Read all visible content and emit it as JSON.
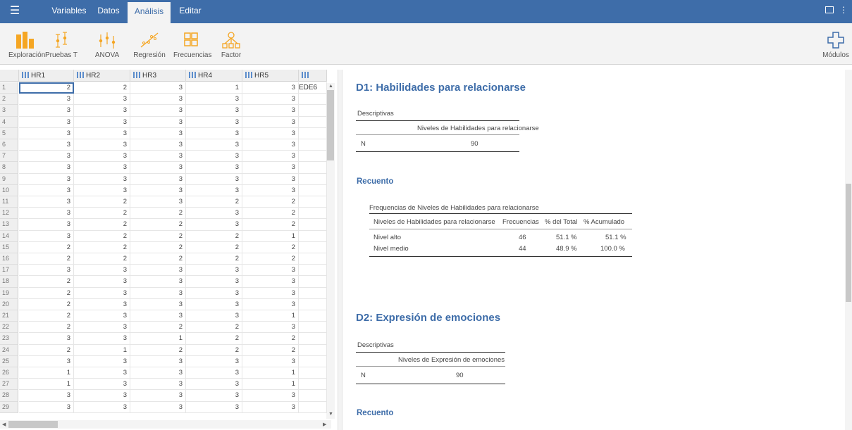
{
  "menu": {
    "tabs": [
      {
        "label": "Variables"
      },
      {
        "label": "Datos"
      },
      {
        "label": "Análisis"
      },
      {
        "label": "Editar"
      }
    ]
  },
  "ribbon": {
    "buttons": [
      {
        "label": "Exploración",
        "icon": "exploration-icon"
      },
      {
        "label": "Pruebas T",
        "icon": "ttest-icon"
      },
      {
        "label": "ANOVA",
        "icon": "anova-icon"
      },
      {
        "label": "Regresión",
        "icon": "regression-icon"
      },
      {
        "label": "Frecuencias",
        "icon": "frequencies-icon"
      },
      {
        "label": "Factor",
        "icon": "factor-icon"
      }
    ],
    "modules_label": "Módulos"
  },
  "sheet": {
    "columns": [
      "HR1",
      "HR2",
      "HR3",
      "HR4",
      "HR5",
      "EDE6"
    ],
    "rows": [
      [
        2,
        2,
        3,
        1,
        3
      ],
      [
        3,
        3,
        3,
        3,
        3
      ],
      [
        3,
        3,
        3,
        3,
        3
      ],
      [
        3,
        3,
        3,
        3,
        3
      ],
      [
        3,
        3,
        3,
        3,
        3
      ],
      [
        3,
        3,
        3,
        3,
        3
      ],
      [
        3,
        3,
        3,
        3,
        3
      ],
      [
        3,
        3,
        3,
        3,
        3
      ],
      [
        3,
        3,
        3,
        3,
        3
      ],
      [
        3,
        3,
        3,
        3,
        3
      ],
      [
        3,
        2,
        3,
        2,
        2
      ],
      [
        3,
        2,
        2,
        3,
        2
      ],
      [
        3,
        2,
        2,
        3,
        2
      ],
      [
        3,
        2,
        2,
        2,
        1
      ],
      [
        2,
        2,
        2,
        2,
        2
      ],
      [
        2,
        2,
        2,
        2,
        2
      ],
      [
        3,
        3,
        3,
        3,
        3
      ],
      [
        2,
        3,
        3,
        3,
        3
      ],
      [
        2,
        3,
        3,
        3,
        3
      ],
      [
        2,
        3,
        3,
        3,
        3
      ],
      [
        2,
        3,
        3,
        3,
        1
      ],
      [
        2,
        3,
        2,
        2,
        3
      ],
      [
        3,
        3,
        1,
        2,
        2
      ],
      [
        2,
        1,
        2,
        2,
        2
      ],
      [
        3,
        3,
        3,
        3,
        3
      ],
      [
        1,
        3,
        3,
        3,
        1
      ],
      [
        1,
        3,
        3,
        3,
        1
      ],
      [
        3,
        3,
        3,
        3,
        3
      ],
      [
        3,
        3,
        3,
        3,
        3
      ]
    ]
  },
  "results": {
    "d1": {
      "title": "D1: Habilidades para relacionarse",
      "desc_title": "Descriptivas",
      "desc_col": "Niveles de Habilidades para relacionarse",
      "desc_row_label": "N",
      "desc_row_value": "90",
      "recuento": "Recuento",
      "freq_title": "Frequencias de Niveles de Habilidades para relacionarse",
      "freq_cols": [
        "Niveles de Habilidades para relacionarse",
        "Frecuencias",
        "% del Total",
        "% Acumulado"
      ],
      "freq_rows": [
        [
          "Nivel alto",
          "46",
          "51.1 %",
          "51.1 %"
        ],
        [
          "Nivel medio",
          "44",
          "48.9 %",
          "100.0 %"
        ]
      ]
    },
    "d2": {
      "title": "D2: Expresión de emociones",
      "desc_title": "Descriptivas",
      "desc_col": "Niveles de Expresión de emociones",
      "desc_row_label": "N",
      "desc_row_value": "90",
      "recuento": "Recuento"
    }
  }
}
